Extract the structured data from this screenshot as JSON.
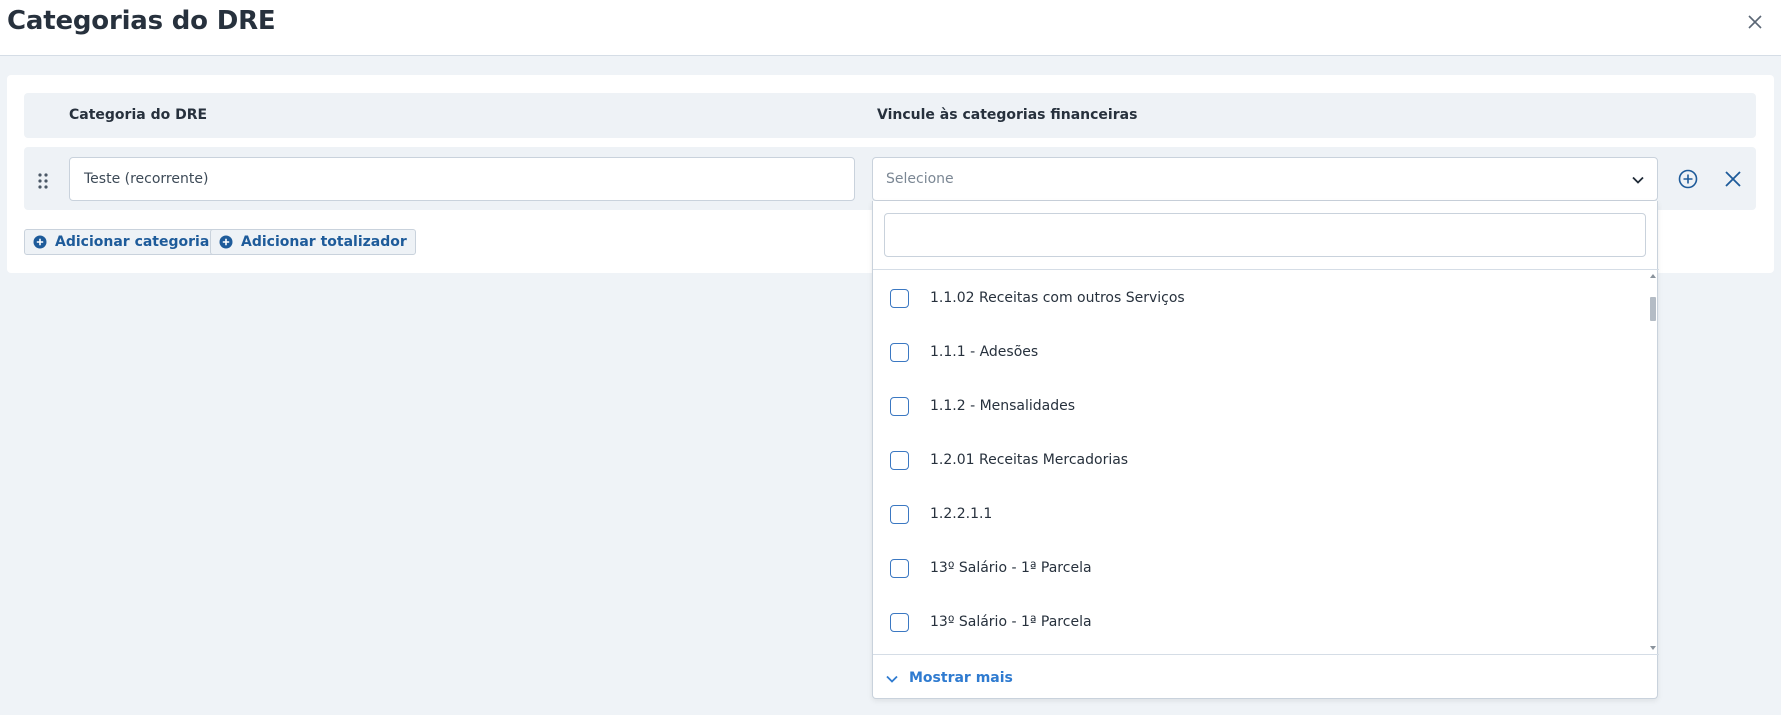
{
  "header": {
    "title": "Categorias do DRE"
  },
  "table": {
    "col_category": "Categoria do DRE",
    "col_link": "Vincule às categorias financeiras"
  },
  "row": {
    "category_value": "Teste (recorrente)",
    "select_placeholder": "Selecione"
  },
  "actions": {
    "add_category": "Adicionar categoria",
    "add_totalizer": "Adicionar totalizador"
  },
  "dropdown": {
    "search_value": "",
    "options": [
      {
        "label": "1.1.02 Receitas com outros Serviços",
        "checked": false
      },
      {
        "label": "1.1.1 - Adesões",
        "checked": false
      },
      {
        "label": "1.1.2 - Mensalidades",
        "checked": false
      },
      {
        "label": "1.2.01 Receitas Mercadorias",
        "checked": false
      },
      {
        "label": "1.2.2.1.1",
        "checked": false
      },
      {
        "label": "13º Salário - 1ª Parcela",
        "checked": false
      },
      {
        "label": "13º Salário - 1ª Parcela",
        "checked": false
      }
    ],
    "show_more": "Mostrar mais"
  },
  "icons": {
    "close": "close-icon",
    "drag": "drag-handle-icon",
    "chevron": "chevron-down-icon",
    "add": "plus-circle-icon",
    "remove": "x-icon"
  },
  "colors": {
    "accent": "#1e5b9a",
    "link": "#2f7bd0",
    "checkbox": "#3b78c2",
    "background": "#eff3f7"
  }
}
